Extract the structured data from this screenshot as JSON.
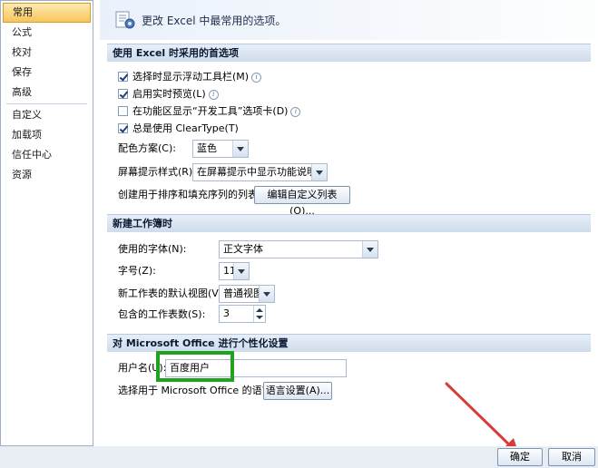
{
  "sidebar": {
    "items": [
      {
        "label": "常用",
        "selected": true
      },
      {
        "label": "公式"
      },
      {
        "label": "校对"
      },
      {
        "label": "保存"
      },
      {
        "label": "高级"
      },
      {
        "label": "自定义"
      },
      {
        "label": "加载项"
      },
      {
        "label": "信任中心"
      },
      {
        "label": "资源"
      }
    ]
  },
  "banner": {
    "title": "更改 Excel 中最常用的选项。",
    "icon": "options-icon"
  },
  "section1": {
    "header": "使用 Excel 时采用的首选项",
    "options": [
      {
        "label": "选择时显示浮动工具栏(M)",
        "checked": true,
        "info": true
      },
      {
        "label": "启用实时预览(L)",
        "checked": true,
        "info": true
      },
      {
        "label": "在功能区显示“开发工具”选项卡(D)",
        "checked": false,
        "info": true
      },
      {
        "label": "总是使用 ClearType(T)",
        "checked": true,
        "info": false
      }
    ],
    "color_scheme_label": "配色方案(C):",
    "color_scheme_value": "蓝色",
    "tooltip_style_label": "屏幕提示样式(R):",
    "tooltip_style_value": "在屏幕提示中显示功能说明",
    "custom_list_label": "创建用于排序和填充序列的列表:",
    "custom_list_button": "编辑自定义列表(O)..."
  },
  "section2": {
    "header": "新建工作簿时",
    "font_label": "使用的字体(N):",
    "font_value": "正文字体",
    "size_label": "字号(Z):",
    "size_value": "11",
    "view_label": "新工作表的默认视图(V):",
    "view_value": "普通视图",
    "sheets_label": "包含的工作表数(S):",
    "sheets_value": "3"
  },
  "section3": {
    "header": "对 Microsoft Office 进行个性化设置",
    "username_label": "用户名(U):",
    "username_value": "百度用户",
    "language_label": "选择用于 Microsoft Office 的语言:",
    "language_button": "语言设置(A)..."
  },
  "footer": {
    "ok": "确定",
    "cancel": "取消"
  },
  "colors": {
    "highlight": "#1fa21f",
    "arrow": "#d93a3a"
  }
}
